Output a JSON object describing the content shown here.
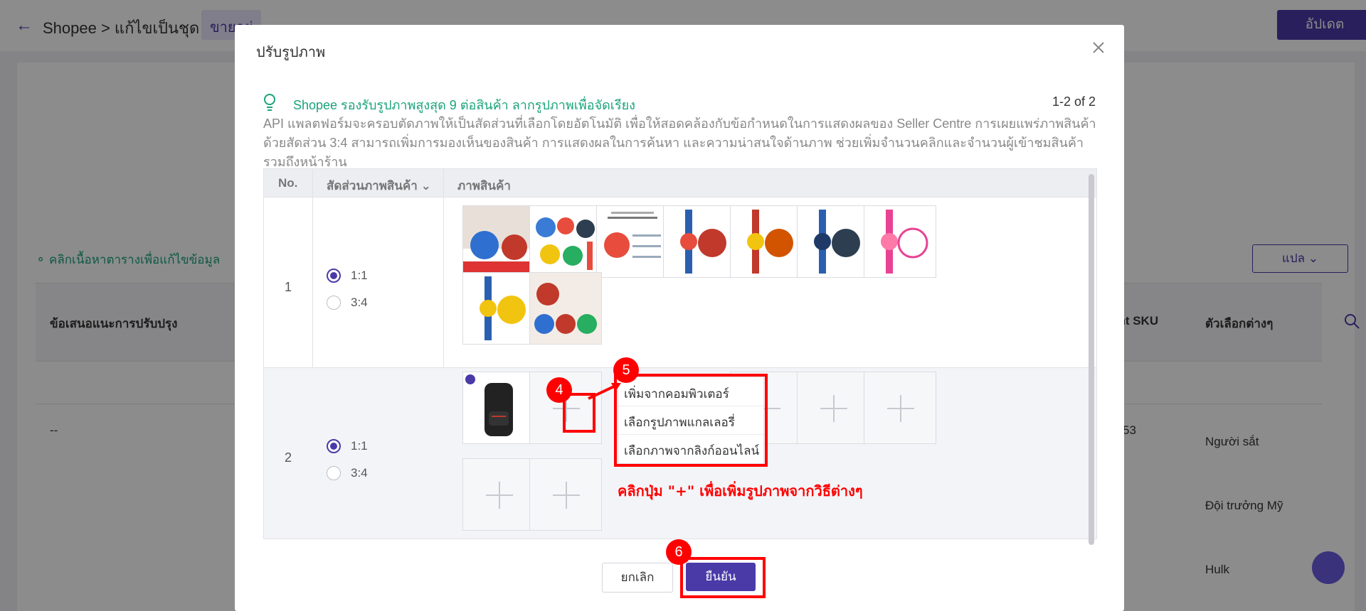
{
  "header": {
    "breadcrumb": "Shopee > แก้ไขเป็นชุด",
    "tag": "ขายอยู่",
    "update_button": "อัปเดต"
  },
  "background": {
    "hint": "คลิกเนื้อหาตารางเพื่อแก้ไขข้อมูล",
    "translate_button": "แปล",
    "columns": [
      "ข้อเสนอแนะการปรับปรุง",
      "ent SKU",
      "ตัวเลือกต่างๆ"
    ],
    "row_dash": "--",
    "row_number": "53",
    "options": [
      "Người sắt",
      "Đội trưởng Mỹ",
      "Hulk"
    ]
  },
  "modal": {
    "title": "ปรับรูปภาพ",
    "tip_title": "Shopee รองรับรูปภาพสูงสุด 9 ต่อสินค้า ลากรูปภาพเพื่อจัดเรียง",
    "pagination": "1-2 of 2",
    "tip_body": "API แพลตฟอร์มจะครอบตัดภาพให้เป็นสัดส่วนที่เลือกโดยอัตโนมัติ เพื่อให้สอดคล้องกับข้อกำหนดในการแสดงผลของ Seller Centre การเผยแพร่ภาพสินค้าด้วยสัดส่วน 3:4 สามารถเพิ่มการมองเห็นของสินค้า การแสดงผลในการค้นหา และความน่าสนใจด้านภาพ ช่วยเพิ่มจำนวนคลิกและจำนวนผู้เข้าชมสินค้ารวมถึงหน้าร้าน",
    "columns": {
      "no": "No.",
      "ratio": "สัดส่วนภาพสินค้า",
      "images": "ภาพสินค้า"
    },
    "rows": [
      {
        "no": "1",
        "ratio_options": [
          "1:1",
          "3:4"
        ],
        "selected": "1:1",
        "image_count": 9
      },
      {
        "no": "2",
        "ratio_options": [
          "1:1",
          "3:4"
        ],
        "selected": "1:1",
        "image_count": 1
      }
    ],
    "add_menu": [
      "เพิ่มจากคอมพิวเตอร์",
      "เลือกรูปภาพแกลเลอรี่",
      "เลือกภาพจากลิงก์ออนไลน์"
    ],
    "annotation_text": "คลิกปุ่ม \"+\" เพื่อเพิ่มรูปภาพจากวิธีต่างๆ",
    "step_badges": [
      "4",
      "5",
      "6"
    ],
    "cancel_button": "ยกเลิก",
    "confirm_button": "ยืนยัน"
  },
  "colors": {
    "brand": "#4a3aa8",
    "tip_green": "#1aa37a",
    "annotation_red": "#ff0000"
  }
}
